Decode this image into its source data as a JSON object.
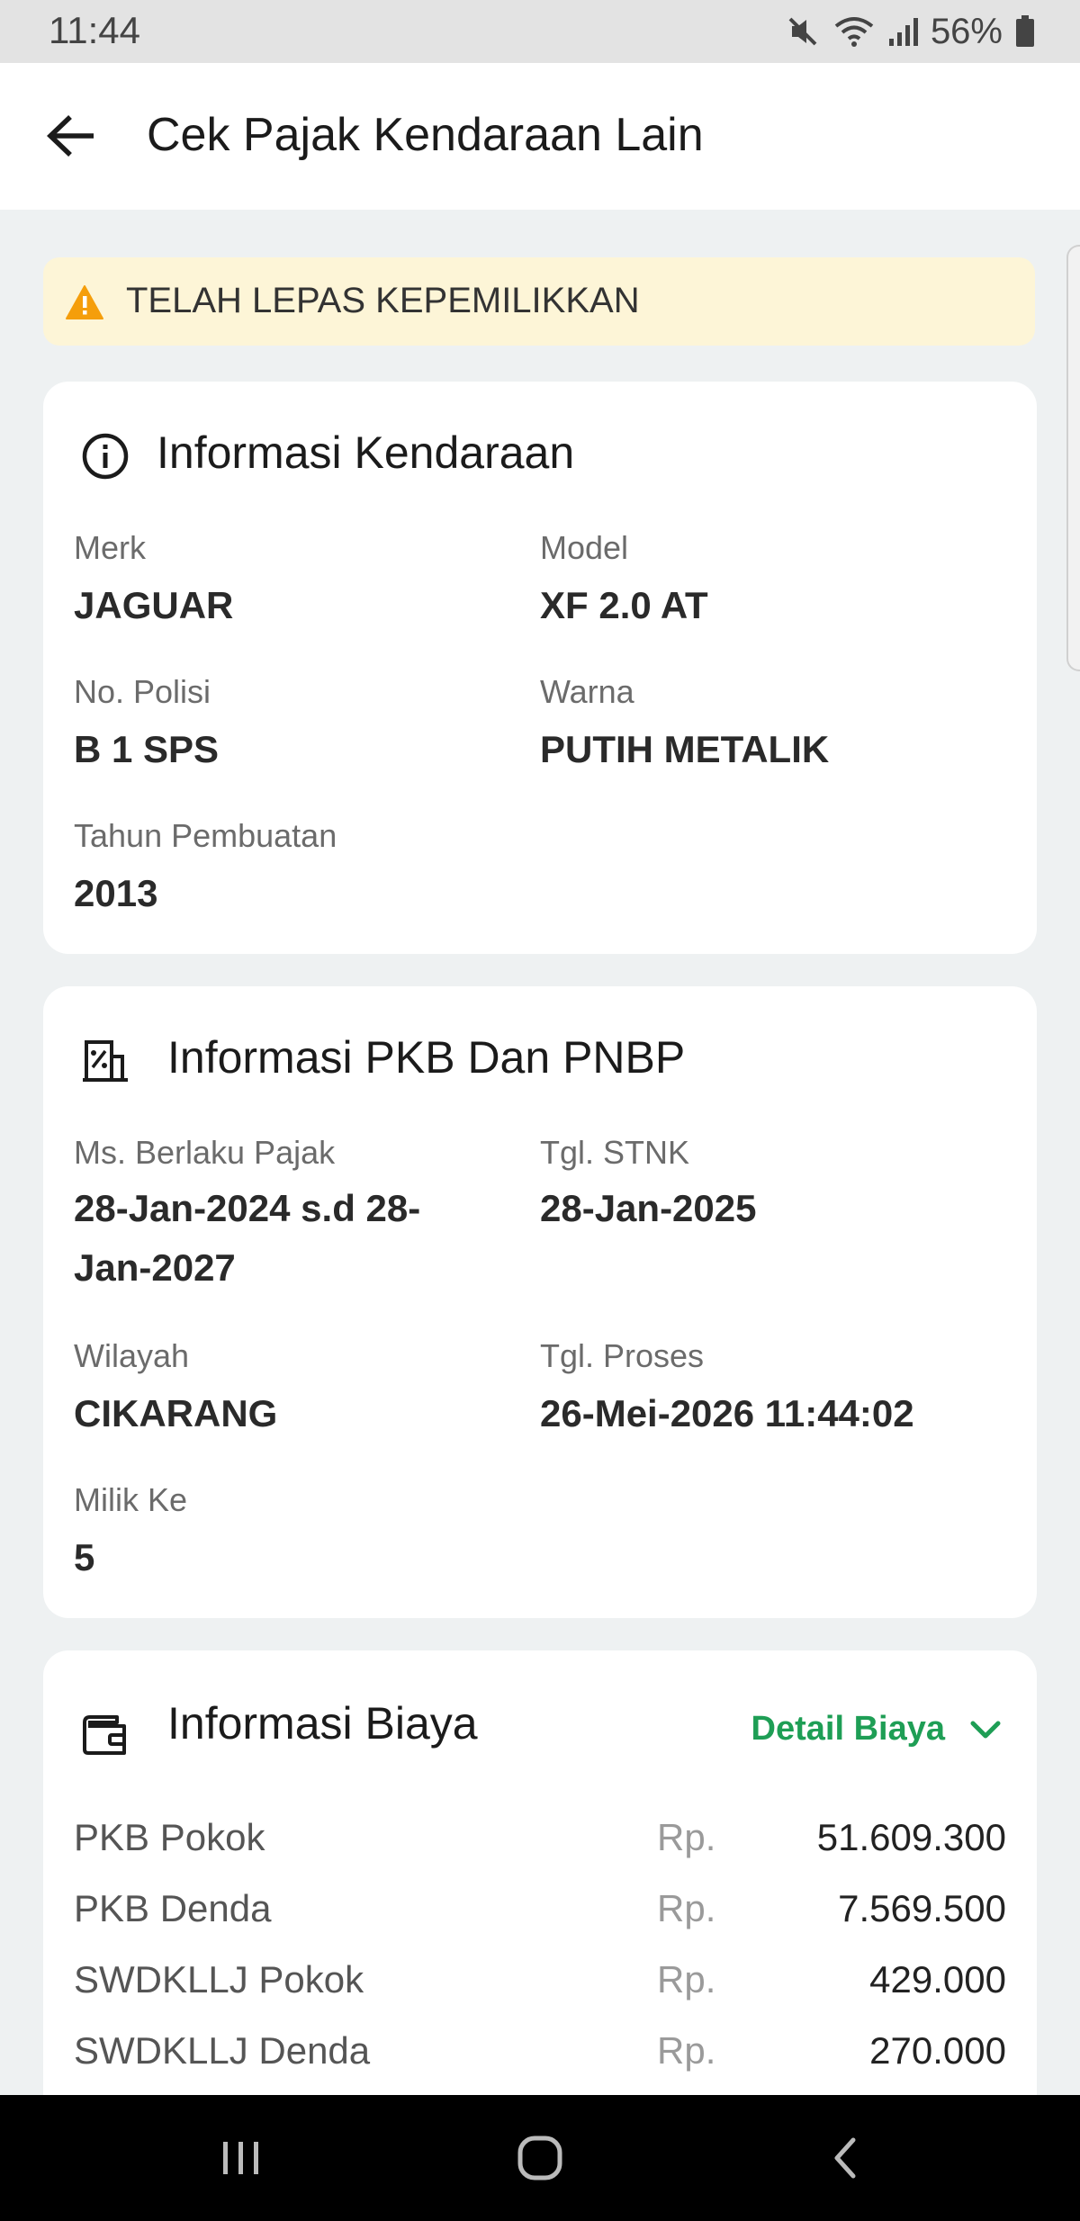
{
  "status_bar": {
    "time": "11:44",
    "battery": "56%"
  },
  "header": {
    "title": "Cek Pajak Kendaraan Lain"
  },
  "alert": {
    "text": "TELAH LEPAS KEPEMILIKKAN",
    "icon": "warning-icon",
    "color": "#f59e0b"
  },
  "vehicle_info": {
    "title": "Informasi Kendaraan",
    "icon": "info-icon",
    "fields": [
      {
        "label": "Merk",
        "value": "JAGUAR"
      },
      {
        "label": "Model",
        "value": "XF 2.0 AT"
      },
      {
        "label": "No. Polisi",
        "value": "B 1 SPS"
      },
      {
        "label": "Warna",
        "value": "PUTIH METALIK"
      },
      {
        "label": "Tahun Pembuatan",
        "value": "2013"
      }
    ]
  },
  "pkb_info": {
    "title": "Informasi PKB Dan PNBP",
    "icon": "tax-document-icon",
    "fields": [
      {
        "label": "Ms. Berlaku Pajak",
        "value_line1": "28-Jan-2024 s.d 28-",
        "value_line2": "Jan-2027"
      },
      {
        "label": "Tgl. STNK",
        "value": "28-Jan-2025"
      },
      {
        "label": "Wilayah",
        "value": "CIKARANG"
      },
      {
        "label": "Tgl. Proses",
        "value": "26-Mei-2026 11:44:02"
      },
      {
        "label": "Milik Ke",
        "value": "5"
      }
    ]
  },
  "fee_info": {
    "title": "Informasi Biaya",
    "icon": "wallet-icon",
    "detail_label": "Detail Biaya",
    "accent": "#1e9e55",
    "currency": "Rp.",
    "rows": [
      {
        "name": "PKB Pokok",
        "amount": "51.609.300"
      },
      {
        "name": "PKB Denda",
        "amount": "7.569.500"
      },
      {
        "name": "SWDKLLJ Pokok",
        "amount": "429.000"
      },
      {
        "name": "SWDKLLJ Denda",
        "amount": "270.000"
      }
    ]
  }
}
